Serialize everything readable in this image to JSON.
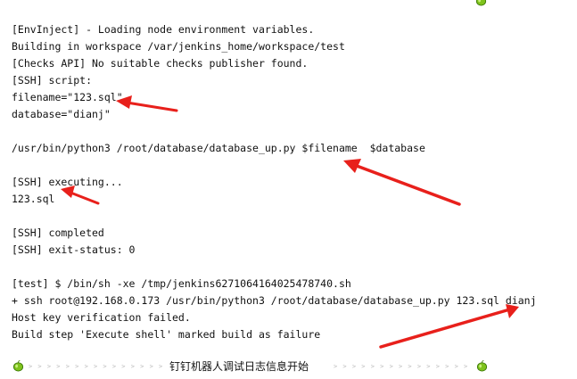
{
  "console_lines": [
    "[EnvInject] - Loading node environment variables.",
    "Building in workspace /var/jenkins_home/workspace/test",
    "[Checks API] No suitable checks publisher found.",
    "[SSH] script:",
    "filename=\"123.sql\"",
    "database=\"dianj\"",
    "",
    "/usr/bin/python3 /root/database/database_up.py $filename  $database",
    "",
    "[SSH] executing...",
    "123.sql",
    "",
    "[SSH] completed",
    "[SSH] exit-status: 0",
    "",
    "[test] $ /bin/sh -xe /tmp/jenkins6271064164025478740.sh",
    "+ ssh root@192.168.0.173 /usr/bin/python3 /root/database/database_up.py 123.sql dianj",
    "Host key verification failed.",
    "Build step 'Execute shell' marked build as failure"
  ],
  "separator": {
    "title": "钉钉机器人调试日志信息开始",
    "dash_text": "> > > > > > > > > > > > > > > > > > > > > > > > > > > > > > > > > > > > > >"
  },
  "colors": {
    "arrow": "#e8201b",
    "apple_green": "#7fc31c",
    "apple_dark": "#3e7a0a"
  },
  "icons": [
    "apple-icon",
    "arrow-annotation"
  ]
}
